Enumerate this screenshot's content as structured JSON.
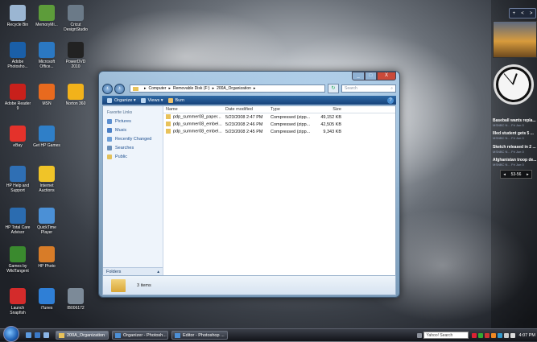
{
  "desktop_icons": [
    {
      "label": "Recycle Bin",
      "icon": "recycle-bin-icon",
      "color": "#9bb6d2"
    },
    {
      "label": "MemoryMi...",
      "icon": "memory-icon",
      "color": "#5d9c3a"
    },
    {
      "label": "Cricut DesignStudio",
      "icon": "cricut-icon",
      "color": "#6b7a88"
    },
    {
      "label": "Adobe Photosho...",
      "icon": "photoshop-icon",
      "color": "#1a5fa8"
    },
    {
      "label": "Microsoft Office...",
      "icon": "office-icon",
      "color": "#2b78c2"
    },
    {
      "label": "PowerDVD 2010",
      "icon": "powerdvd-icon",
      "color": "#222222"
    },
    {
      "label": "Adobe Reader 9",
      "icon": "adobe-reader-icon",
      "color": "#c8201b"
    },
    {
      "label": "MSN",
      "icon": "msn-icon",
      "color": "#e86a1e"
    },
    {
      "label": "Norton 360",
      "icon": "norton-icon",
      "color": "#f2b21a"
    },
    {
      "label": "eBay",
      "icon": "ebay-icon",
      "color": "#e4322b"
    },
    {
      "label": "Get HP Games",
      "icon": "hp-games-icon",
      "color": "#2f7fc8"
    },
    {
      "label": "HP Help and Support",
      "icon": "help-icon",
      "color": "#2f6fb4"
    },
    {
      "label": "Internet Auctions",
      "icon": "auction-icon",
      "color": "#f0c428"
    },
    {
      "label": "HP Total Care Advisor",
      "icon": "hp-care-icon",
      "color": "#2b6cb0"
    },
    {
      "label": "QuickTime Player",
      "icon": "quicktime-icon",
      "color": "#4b90d6"
    },
    {
      "label": "Games by WildTangent",
      "icon": "wildtangent-icon",
      "color": "#3a8a2e"
    },
    {
      "label": "HP Photo",
      "icon": "hp-photo-icon",
      "color": "#d87c28"
    },
    {
      "label": "Launch Snapfish",
      "icon": "snapfish-icon",
      "color": "#d42b2b"
    },
    {
      "label": "iTunes",
      "icon": "itunes-icon",
      "color": "#2f7fd6"
    },
    {
      "label": "IB006172",
      "icon": "image-file-icon",
      "color": "#7c8a98"
    }
  ],
  "sidebar": {
    "top_controls": [
      "+",
      "<",
      ">"
    ],
    "feeds": [
      {
        "headline": "Baseball wants repla...",
        "source": "MSNBC N...",
        "time": "Fri Jun 0"
      },
      {
        "headline": "Illed student gets 5 ...",
        "source": "MSNBC N...",
        "time": "Fri Jun 0"
      },
      {
        "headline": "Sketch released in 2 ...",
        "source": "MSNBC N...",
        "time": "Fri Jun 0"
      },
      {
        "headline": "Afghanistan troop de...",
        "source": "MSNBC N...",
        "time": "Fri Jun 0"
      }
    ],
    "pager": "53-56"
  },
  "window": {
    "controls": {
      "minimize": "_",
      "maximize": "□",
      "close": "X"
    },
    "breadcrumb": [
      "Computer",
      "Removable Disk (F:)",
      "200A_Organization"
    ],
    "search_placeholder": "Search",
    "toolbar": {
      "organize": "Organize",
      "views": "Views",
      "burn": "Burn"
    },
    "nav": {
      "title": "Favorite Links",
      "links": [
        {
          "label": "Pictures",
          "color": "#5b8fd0"
        },
        {
          "label": "Music",
          "color": "#4a7fc5"
        },
        {
          "label": "Recently Changed",
          "color": "#6ea0d8"
        },
        {
          "label": "Searches",
          "color": "#6a8fb8"
        },
        {
          "label": "Public",
          "color": "#e2c15b"
        }
      ],
      "folders_label": "Folders"
    },
    "columns": [
      "Name",
      "Date modified",
      "Type",
      "Size"
    ],
    "files": [
      {
        "name": "pdp_summer08_paper...",
        "date": "5/23/2008 2:47 PM",
        "type": "Compressed (zipp...",
        "size": "49,152 KB"
      },
      {
        "name": "pdp_summer08_embel...",
        "date": "5/23/2008 2:46 PM",
        "type": "Compressed (zipp...",
        "size": "42,505 KB"
      },
      {
        "name": "pdp_summer08_embel...",
        "date": "5/23/2008 2:45 PM",
        "type": "Compressed (zipp...",
        "size": "9,343 KB"
      }
    ],
    "details": "3 items"
  },
  "taskbar": {
    "tasks": [
      "200A_Organization",
      "Organizer - Photosh...",
      "Editor - Photoshop ..."
    ],
    "search_placeholder": "Yahoo! Search",
    "time": "4:07 PM"
  }
}
